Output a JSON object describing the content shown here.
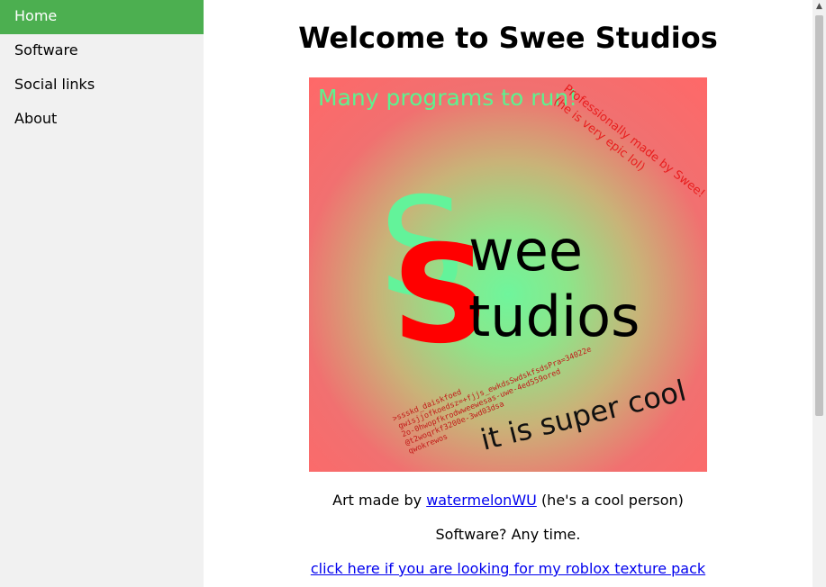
{
  "sidebar": {
    "items": [
      {
        "label": "Home",
        "active": true
      },
      {
        "label": "Software",
        "active": false
      },
      {
        "label": "Social links",
        "active": false
      },
      {
        "label": "About",
        "active": false
      }
    ]
  },
  "main": {
    "title": "Welcome to Swee Studios",
    "art": {
      "top_text": "Many programs to run!",
      "diag_line1": "Professionally made by Swee!",
      "diag_line2": "(he is very epic lol)",
      "big_letter": "S",
      "word1": "wee",
      "word2": "tudios",
      "scribble": [
        ">ssskd_daiskfoed",
        "gwisjjofkoedsz=+fjjs_ewkdsSwdskfsdsPra=34022e",
        "2o-0hwopfkrodwweewesas-uwe-4ed559ored",
        "@t2woqrkf3200e-3wd03dsa",
        "qwokrewos"
      ],
      "bottom_text": "it is super cool",
      "colors": {
        "accent_green": "#6af39a",
        "accent_red": "#ff0000",
        "scribble_red": "#c21818"
      }
    },
    "credit": {
      "prefix": "Art made by",
      "link": "watermelonWU",
      "suffix": "(he's a cool person)"
    },
    "tagline": "Software? Any time.",
    "texture_link": "click here if you are looking for my roblox texture pack"
  },
  "scrollbar": {
    "up_glyph": "▲"
  }
}
